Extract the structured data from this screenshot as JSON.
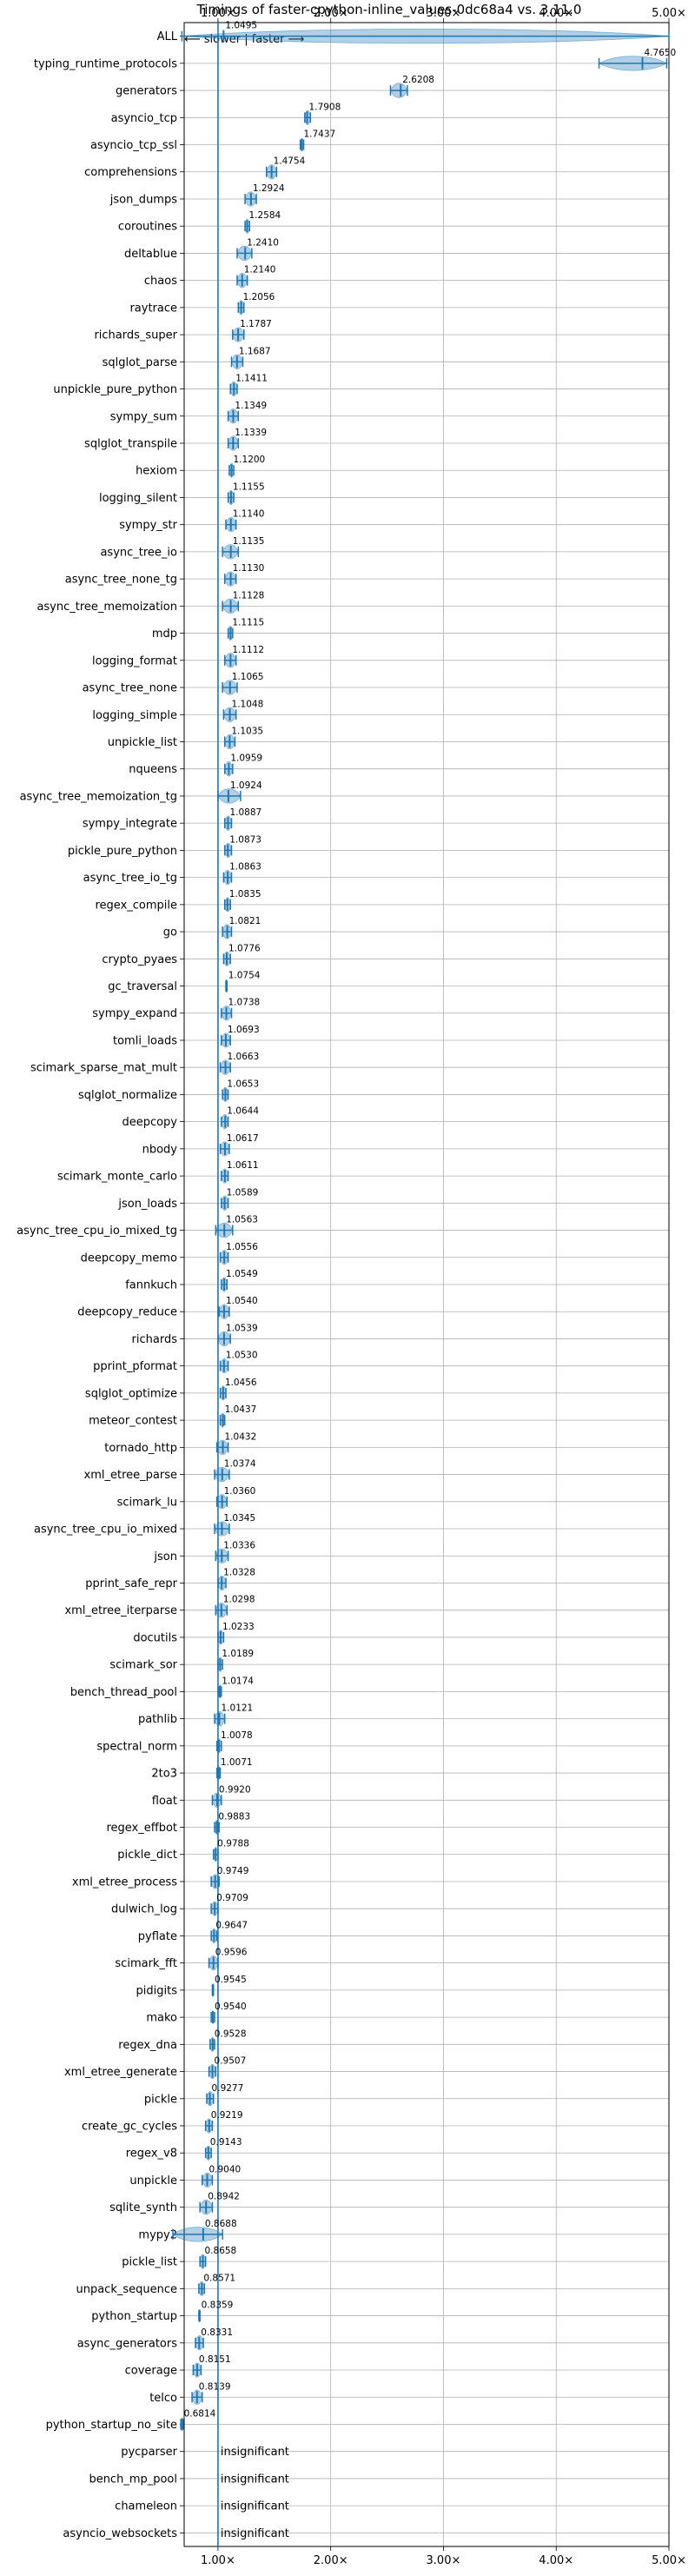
{
  "chart_data": {
    "type": "violin",
    "title": "Timings of faster-cpython-inline_values-0dc68a4 vs. 3.11.0",
    "direction_label": "⟵ slower | faster ⟶",
    "xlim": [
      0.7,
      5.0
    ],
    "x_ticks": [
      {
        "value": 1.0,
        "label": "1.00×"
      },
      {
        "value": 2.0,
        "label": "2.00×"
      },
      {
        "value": 3.0,
        "label": "3.00×"
      },
      {
        "value": 4.0,
        "label": "4.00×"
      },
      {
        "value": 5.0,
        "label": "5.00×"
      }
    ],
    "grid": true,
    "reference_line": 1.0,
    "benchmarks": [
      {
        "name": "ALL",
        "value": 1.0495,
        "label": "1.0495",
        "spread": [
          0.68,
          5.0
        ]
      },
      {
        "name": "typing_runtime_protocols",
        "value": 4.765,
        "label": "4.7650",
        "spread": [
          4.38,
          4.98
        ]
      },
      {
        "name": "generators",
        "value": 2.6208,
        "label": "2.6208",
        "spread": [
          2.53,
          2.68
        ]
      },
      {
        "name": "asyncio_tcp",
        "value": 1.7908,
        "label": "1.7908",
        "spread": [
          1.77,
          1.82
        ]
      },
      {
        "name": "asyncio_tcp_ssl",
        "value": 1.7437,
        "label": "1.7437",
        "spread": [
          1.73,
          1.76
        ]
      },
      {
        "name": "comprehensions",
        "value": 1.4754,
        "label": "1.4754",
        "spread": [
          1.43,
          1.52
        ]
      },
      {
        "name": "json_dumps",
        "value": 1.2924,
        "label": "1.2924",
        "spread": [
          1.24,
          1.34
        ]
      },
      {
        "name": "coroutines",
        "value": 1.2584,
        "label": "1.2584",
        "spread": [
          1.24,
          1.28
        ]
      },
      {
        "name": "deltablue",
        "value": 1.241,
        "label": "1.2410",
        "spread": [
          1.17,
          1.3
        ]
      },
      {
        "name": "chaos",
        "value": 1.214,
        "label": "1.2140",
        "spread": [
          1.17,
          1.26
        ]
      },
      {
        "name": "raytrace",
        "value": 1.2056,
        "label": "1.2056",
        "spread": [
          1.18,
          1.23
        ]
      },
      {
        "name": "richards_super",
        "value": 1.1787,
        "label": "1.1787",
        "spread": [
          1.13,
          1.23
        ]
      },
      {
        "name": "sqlglot_parse",
        "value": 1.1687,
        "label": "1.1687",
        "spread": [
          1.12,
          1.22
        ]
      },
      {
        "name": "unpickle_pure_python",
        "value": 1.1411,
        "label": "1.1411",
        "spread": [
          1.11,
          1.17
        ]
      },
      {
        "name": "sympy_sum",
        "value": 1.1349,
        "label": "1.1349",
        "spread": [
          1.09,
          1.18
        ]
      },
      {
        "name": "sqlglot_transpile",
        "value": 1.1339,
        "label": "1.1339",
        "spread": [
          1.09,
          1.18
        ]
      },
      {
        "name": "hexiom",
        "value": 1.12,
        "label": "1.1200",
        "spread": [
          1.1,
          1.14
        ]
      },
      {
        "name": "logging_silent",
        "value": 1.1155,
        "label": "1.1155",
        "spread": [
          1.09,
          1.14
        ]
      },
      {
        "name": "sympy_str",
        "value": 1.114,
        "label": "1.1140",
        "spread": [
          1.07,
          1.16
        ]
      },
      {
        "name": "async_tree_io",
        "value": 1.1135,
        "label": "1.1135",
        "spread": [
          1.04,
          1.18
        ]
      },
      {
        "name": "async_tree_none_tg",
        "value": 1.113,
        "label": "1.1130",
        "spread": [
          1.06,
          1.16
        ]
      },
      {
        "name": "async_tree_memoization",
        "value": 1.1128,
        "label": "1.1128",
        "spread": [
          1.04,
          1.18
        ]
      },
      {
        "name": "mdp",
        "value": 1.1115,
        "label": "1.1115",
        "spread": [
          1.09,
          1.13
        ]
      },
      {
        "name": "logging_format",
        "value": 1.1112,
        "label": "1.1112",
        "spread": [
          1.06,
          1.16
        ]
      },
      {
        "name": "async_tree_none",
        "value": 1.1065,
        "label": "1.1065",
        "spread": [
          1.04,
          1.17
        ]
      },
      {
        "name": "logging_simple",
        "value": 1.1048,
        "label": "1.1048",
        "spread": [
          1.05,
          1.16
        ]
      },
      {
        "name": "unpickle_list",
        "value": 1.1035,
        "label": "1.1035",
        "spread": [
          1.06,
          1.15
        ]
      },
      {
        "name": "nqueens",
        "value": 1.0959,
        "label": "1.0959",
        "spread": [
          1.06,
          1.13
        ]
      },
      {
        "name": "async_tree_memoization_tg",
        "value": 1.0924,
        "label": "1.0924",
        "spread": [
          1.0,
          1.2
        ]
      },
      {
        "name": "sympy_integrate",
        "value": 1.0887,
        "label": "1.0887",
        "spread": [
          1.06,
          1.12
        ]
      },
      {
        "name": "pickle_pure_python",
        "value": 1.0873,
        "label": "1.0873",
        "spread": [
          1.06,
          1.12
        ]
      },
      {
        "name": "async_tree_io_tg",
        "value": 1.0863,
        "label": "1.0863",
        "spread": [
          1.05,
          1.12
        ]
      },
      {
        "name": "regex_compile",
        "value": 1.0835,
        "label": "1.0835",
        "spread": [
          1.06,
          1.11
        ]
      },
      {
        "name": "go",
        "value": 1.0821,
        "label": "1.0821",
        "spread": [
          1.04,
          1.12
        ]
      },
      {
        "name": "crypto_pyaes",
        "value": 1.0776,
        "label": "1.0776",
        "spread": [
          1.05,
          1.11
        ]
      },
      {
        "name": "gc_traversal",
        "value": 1.0754,
        "label": "1.0754",
        "spread": [
          1.07,
          1.08
        ]
      },
      {
        "name": "sympy_expand",
        "value": 1.0738,
        "label": "1.0738",
        "spread": [
          1.03,
          1.12
        ]
      },
      {
        "name": "tomli_loads",
        "value": 1.0693,
        "label": "1.0693",
        "spread": [
          1.03,
          1.11
        ]
      },
      {
        "name": "scimark_sparse_mat_mult",
        "value": 1.0663,
        "label": "1.0663",
        "spread": [
          1.02,
          1.11
        ]
      },
      {
        "name": "sqlglot_normalize",
        "value": 1.0653,
        "label": "1.0653",
        "spread": [
          1.04,
          1.09
        ]
      },
      {
        "name": "deepcopy",
        "value": 1.0644,
        "label": "1.0644",
        "spread": [
          1.03,
          1.09
        ]
      },
      {
        "name": "nbody",
        "value": 1.0617,
        "label": "1.0617",
        "spread": [
          1.02,
          1.1
        ]
      },
      {
        "name": "scimark_monte_carlo",
        "value": 1.0611,
        "label": "1.0611",
        "spread": [
          1.03,
          1.09
        ]
      },
      {
        "name": "json_loads",
        "value": 1.0589,
        "label": "1.0589",
        "spread": [
          1.03,
          1.09
        ]
      },
      {
        "name": "async_tree_cpu_io_mixed_tg",
        "value": 1.0563,
        "label": "1.0563",
        "spread": [
          0.98,
          1.13
        ]
      },
      {
        "name": "deepcopy_memo",
        "value": 1.0556,
        "label": "1.0556",
        "spread": [
          1.02,
          1.09
        ]
      },
      {
        "name": "fannkuch",
        "value": 1.0549,
        "label": "1.0549",
        "spread": [
          1.03,
          1.08
        ]
      },
      {
        "name": "deepcopy_reduce",
        "value": 1.054,
        "label": "1.0540",
        "spread": [
          1.01,
          1.1
        ]
      },
      {
        "name": "richards",
        "value": 1.0539,
        "label": "1.0539",
        "spread": [
          1.0,
          1.11
        ]
      },
      {
        "name": "pprint_pformat",
        "value": 1.053,
        "label": "1.0530",
        "spread": [
          1.02,
          1.09
        ]
      },
      {
        "name": "sqlglot_optimize",
        "value": 1.0456,
        "label": "1.0456",
        "spread": [
          1.02,
          1.07
        ]
      },
      {
        "name": "meteor_contest",
        "value": 1.0437,
        "label": "1.0437",
        "spread": [
          1.02,
          1.06
        ]
      },
      {
        "name": "tornado_http",
        "value": 1.0432,
        "label": "1.0432",
        "spread": [
          0.99,
          1.09
        ]
      },
      {
        "name": "xml_etree_parse",
        "value": 1.0374,
        "label": "1.0374",
        "spread": [
          0.97,
          1.1
        ]
      },
      {
        "name": "scimark_lu",
        "value": 1.036,
        "label": "1.0360",
        "spread": [
          0.99,
          1.08
        ]
      },
      {
        "name": "async_tree_cpu_io_mixed",
        "value": 1.0345,
        "label": "1.0345",
        "spread": [
          0.97,
          1.1
        ]
      },
      {
        "name": "json",
        "value": 1.0336,
        "label": "1.0336",
        "spread": [
          0.98,
          1.09
        ]
      },
      {
        "name": "pprint_safe_repr",
        "value": 1.0328,
        "label": "1.0328",
        "spread": [
          1.0,
          1.07
        ]
      },
      {
        "name": "xml_etree_iterparse",
        "value": 1.0298,
        "label": "1.0298",
        "spread": [
          0.98,
          1.08
        ]
      },
      {
        "name": "docutils",
        "value": 1.0233,
        "label": "1.0233",
        "spread": [
          1.0,
          1.05
        ]
      },
      {
        "name": "scimark_sor",
        "value": 1.0189,
        "label": "1.0189",
        "spread": [
          1.0,
          1.04
        ]
      },
      {
        "name": "bench_thread_pool",
        "value": 1.0174,
        "label": "1.0174",
        "spread": [
          1.01,
          1.03
        ]
      },
      {
        "name": "pathlib",
        "value": 1.0121,
        "label": "1.0121",
        "spread": [
          0.97,
          1.06
        ]
      },
      {
        "name": "spectral_norm",
        "value": 1.0078,
        "label": "1.0078",
        "spread": [
          0.99,
          1.03
        ]
      },
      {
        "name": "2to3",
        "value": 1.0071,
        "label": "1.0071",
        "spread": [
          0.99,
          1.02
        ]
      },
      {
        "name": "float",
        "value": 0.992,
        "label": "0.9920",
        "spread": [
          0.95,
          1.03
        ]
      },
      {
        "name": "regex_effbot",
        "value": 0.9883,
        "label": "0.9883",
        "spread": [
          0.97,
          1.01
        ]
      },
      {
        "name": "pickle_dict",
        "value": 0.9788,
        "label": "0.9788",
        "spread": [
          0.96,
          1.0
        ]
      },
      {
        "name": "xml_etree_process",
        "value": 0.9749,
        "label": "0.9749",
        "spread": [
          0.94,
          1.01
        ]
      },
      {
        "name": "dulwich_log",
        "value": 0.9709,
        "label": "0.9709",
        "spread": [
          0.94,
          1.0
        ]
      },
      {
        "name": "pyflate",
        "value": 0.9647,
        "label": "0.9647",
        "spread": [
          0.94,
          0.99
        ]
      },
      {
        "name": "scimark_fft",
        "value": 0.9596,
        "label": "0.9596",
        "spread": [
          0.92,
          1.0
        ]
      },
      {
        "name": "pidigits",
        "value": 0.9545,
        "label": "0.9545",
        "spread": [
          0.95,
          0.96
        ]
      },
      {
        "name": "mako",
        "value": 0.954,
        "label": "0.9540",
        "spread": [
          0.94,
          0.97
        ]
      },
      {
        "name": "regex_dna",
        "value": 0.9528,
        "label": "0.9528",
        "spread": [
          0.93,
          0.97
        ]
      },
      {
        "name": "xml_etree_generate",
        "value": 0.9507,
        "label": "0.9507",
        "spread": [
          0.92,
          0.98
        ]
      },
      {
        "name": "pickle",
        "value": 0.9277,
        "label": "0.9277",
        "spread": [
          0.9,
          0.96
        ]
      },
      {
        "name": "create_gc_cycles",
        "value": 0.9219,
        "label": "0.9219",
        "spread": [
          0.89,
          0.95
        ]
      },
      {
        "name": "regex_v8",
        "value": 0.9143,
        "label": "0.9143",
        "spread": [
          0.89,
          0.94
        ]
      },
      {
        "name": "unpickle",
        "value": 0.904,
        "label": "0.9040",
        "spread": [
          0.86,
          0.95
        ]
      },
      {
        "name": "sqlite_synth",
        "value": 0.8942,
        "label": "0.8942",
        "spread": [
          0.84,
          0.95
        ]
      },
      {
        "name": "mypy2",
        "value": 0.8688,
        "label": "0.8688",
        "spread": [
          0.6,
          1.04
        ]
      },
      {
        "name": "pickle_list",
        "value": 0.8658,
        "label": "0.8658",
        "spread": [
          0.84,
          0.89
        ]
      },
      {
        "name": "unpack_sequence",
        "value": 0.8571,
        "label": "0.8571",
        "spread": [
          0.83,
          0.88
        ]
      },
      {
        "name": "python_startup",
        "value": 0.8359,
        "label": "0.8359",
        "spread": [
          0.83,
          0.84
        ]
      },
      {
        "name": "async_generators",
        "value": 0.8331,
        "label": "0.8331",
        "spread": [
          0.8,
          0.87
        ]
      },
      {
        "name": "coverage",
        "value": 0.8151,
        "label": "0.8151",
        "spread": [
          0.78,
          0.85
        ]
      },
      {
        "name": "telco",
        "value": 0.8139,
        "label": "0.8139",
        "spread": [
          0.77,
          0.86
        ]
      },
      {
        "name": "python_startup_no_site",
        "value": 0.6814,
        "label": "0.6814",
        "spread": [
          0.67,
          0.69
        ]
      },
      {
        "name": "pycparser",
        "value": null,
        "label": "insignificant",
        "spread": null
      },
      {
        "name": "bench_mp_pool",
        "value": null,
        "label": "insignificant",
        "spread": null
      },
      {
        "name": "chameleon",
        "value": null,
        "label": "insignificant",
        "spread": null
      },
      {
        "name": "asyncio_websockets",
        "value": null,
        "label": "insignificant",
        "spread": null
      }
    ]
  }
}
